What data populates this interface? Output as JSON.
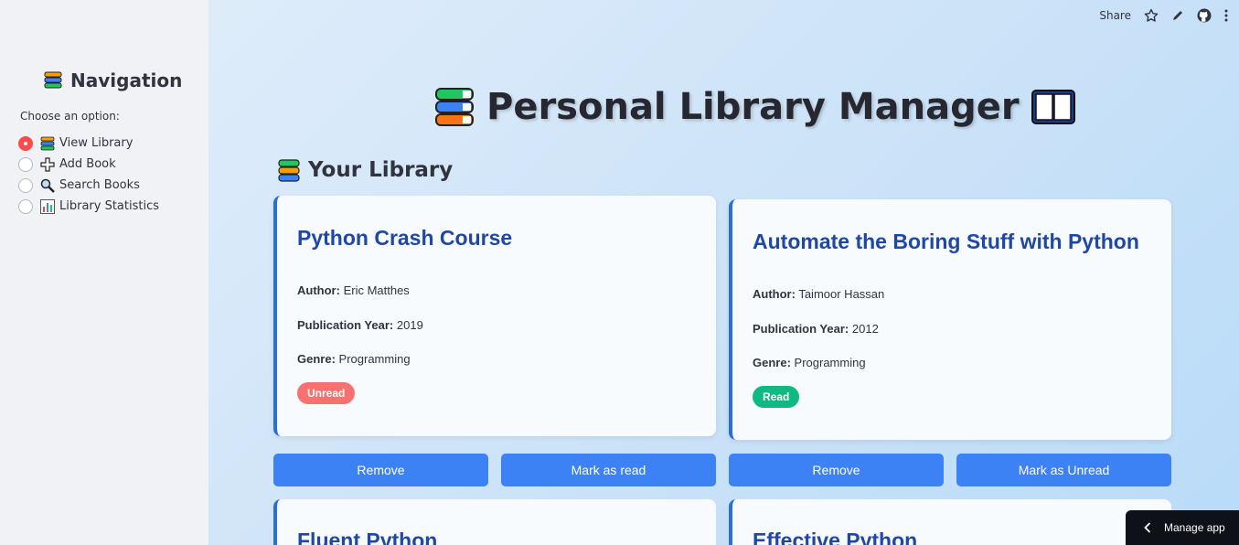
{
  "sidebar": {
    "title": "Navigation",
    "label": "Choose an option:",
    "options": [
      {
        "label": "View Library",
        "icon": "books-icon",
        "selected": true
      },
      {
        "label": "Add Book",
        "icon": "plus-icon",
        "selected": false
      },
      {
        "label": "Search Books",
        "icon": "magnifier-icon",
        "selected": false
      },
      {
        "label": "Library Statistics",
        "icon": "bar-chart-icon",
        "selected": false
      }
    ]
  },
  "topbar": {
    "share": "Share"
  },
  "main": {
    "title": "Personal Library Manager",
    "section_title": "Your Library",
    "books": [
      {
        "title": "Python Crash Course",
        "author_label": "Author:",
        "author": "Eric Matthes",
        "year_label": "Publication Year:",
        "year": "2019",
        "genre_label": "Genre:",
        "genre": "Programming",
        "status": "Unread",
        "remove": "Remove",
        "toggle": "Mark as read"
      },
      {
        "title": "Automate the Boring Stuff with Python",
        "author_label": "Author:",
        "author": "Taimoor Hassan",
        "year_label": "Publication Year:",
        "year": "2012",
        "genre_label": "Genre:",
        "genre": "Programming",
        "status": "Read",
        "remove": "Remove",
        "toggle": "Mark as Unread"
      },
      {
        "title": "Fluent Python"
      },
      {
        "title": "Effective Python"
      }
    ]
  },
  "manage_app": "Manage app",
  "colors": {
    "accent": "#3d82f5",
    "unread": "#f87171",
    "read": "#10b981",
    "title": "#1f47a3"
  }
}
